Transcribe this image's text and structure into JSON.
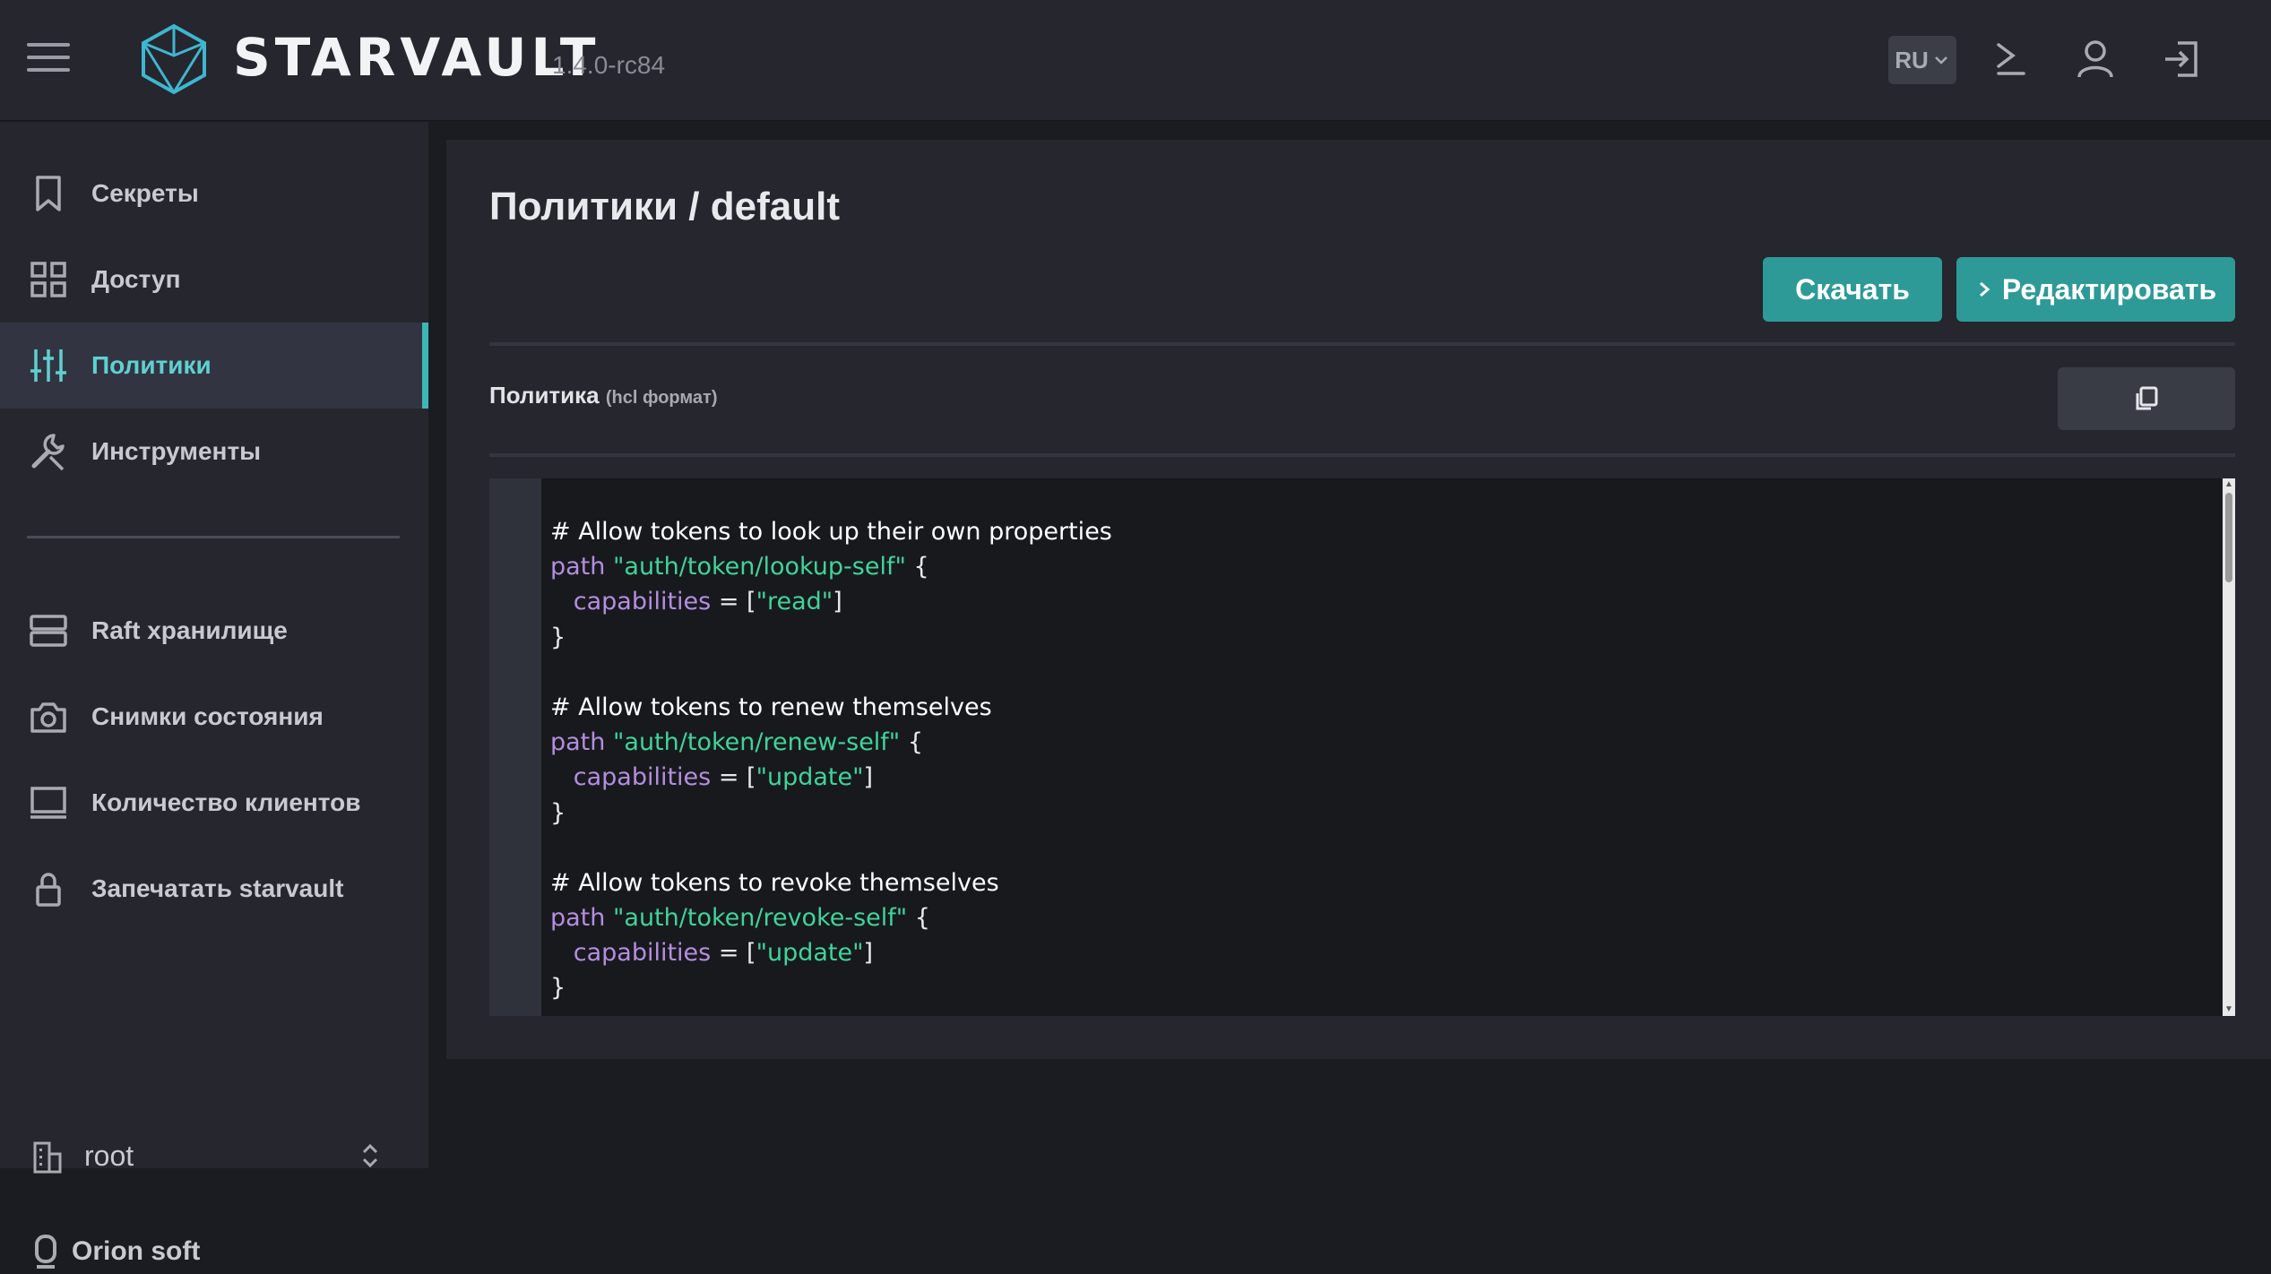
{
  "app": {
    "logo_text": "STARVAULT",
    "version": "1.4.0-rc84",
    "language": "RU"
  },
  "sidebar": {
    "items": [
      {
        "label": "Секреты",
        "icon": "bookmark-icon"
      },
      {
        "label": "Доступ",
        "icon": "grid-icon"
      },
      {
        "label": "Политики",
        "icon": "sliders-icon",
        "active": true
      },
      {
        "label": "Инструменты",
        "icon": "wrench-icon"
      }
    ],
    "items2": [
      {
        "label": "Raft хранилище",
        "icon": "server-icon"
      },
      {
        "label": "Снимки состояния",
        "icon": "camera-icon"
      },
      {
        "label": "Количество клиентов",
        "icon": "monitor-icon"
      },
      {
        "label": "Запечатать starvault",
        "icon": "lock-icon"
      }
    ],
    "namespace": "root",
    "brand": "Orion soft"
  },
  "main": {
    "title": "Политики / default",
    "download_label": "Скачать",
    "edit_label": "Редактировать",
    "policy_label": "Политика",
    "policy_format": "(hcl формат)"
  },
  "code": {
    "lines": [
      {
        "type": "comment",
        "text": "# Allow tokens to look up their own properties"
      },
      {
        "type": "path",
        "path": "\"auth/token/lookup-self\""
      },
      {
        "type": "cap",
        "value": "\"read\""
      },
      {
        "type": "close"
      },
      {
        "type": "blank"
      },
      {
        "type": "comment",
        "text": "# Allow tokens to renew themselves"
      },
      {
        "type": "path",
        "path": "\"auth/token/renew-self\""
      },
      {
        "type": "cap",
        "value": "\"update\""
      },
      {
        "type": "close"
      },
      {
        "type": "blank"
      },
      {
        "type": "comment",
        "text": "# Allow tokens to revoke themselves"
      },
      {
        "type": "path",
        "path": "\"auth/token/revoke-self\""
      },
      {
        "type": "cap",
        "value": "\"update\""
      },
      {
        "type": "close"
      }
    ],
    "keyword_path": "path",
    "keyword_capabilities": "capabilities",
    "open_brace": " {",
    "equals": " = [",
    "close_bracket": "]",
    "close_brace": "}"
  },
  "colors": {
    "accent": "#2e9a98",
    "active_text": "#5fd0d0",
    "keyword": "#b48ee0",
    "string": "#3fd49a"
  }
}
